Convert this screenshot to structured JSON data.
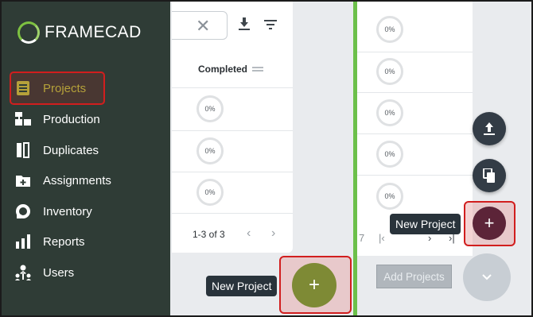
{
  "brand": {
    "name": "FRAMECAD"
  },
  "sidebar": {
    "items": [
      {
        "label": "Projects",
        "icon": "projects-icon",
        "active": true
      },
      {
        "label": "Production",
        "icon": "production-icon"
      },
      {
        "label": "Duplicates",
        "icon": "duplicates-icon"
      },
      {
        "label": "Assignments",
        "icon": "assignments-icon"
      },
      {
        "label": "Inventory",
        "icon": "inventory-icon"
      },
      {
        "label": "Reports",
        "icon": "reports-icon"
      },
      {
        "label": "Users",
        "icon": "users-icon"
      }
    ]
  },
  "table": {
    "column_header": "Completed",
    "rows": [
      {
        "completed": "0%"
      },
      {
        "completed": "0%"
      },
      {
        "completed": "0%"
      }
    ],
    "pager": "1-3 of 3",
    "icons": [
      "close-icon",
      "download-icon",
      "filter-icon"
    ]
  },
  "right_panel": {
    "rows": [
      "0%",
      "0%",
      "0%",
      "0%",
      "0%"
    ],
    "pager_fragment": "7"
  },
  "actions": {
    "new_project_tooltip": "New Project",
    "add_projects_label": "Add Projects",
    "fab_icons": [
      "upload-icon",
      "copy-icon",
      "plus-icon",
      "chevron-down-icon"
    ]
  },
  "colors": {
    "sidebar_bg": "#2f3c36",
    "accent_green": "#6cc04a",
    "active_text": "#b5a13a",
    "highlight_red": "#d11e1e",
    "fab_olive": "#7e8a35",
    "fab_maroon": "#5c2438"
  }
}
